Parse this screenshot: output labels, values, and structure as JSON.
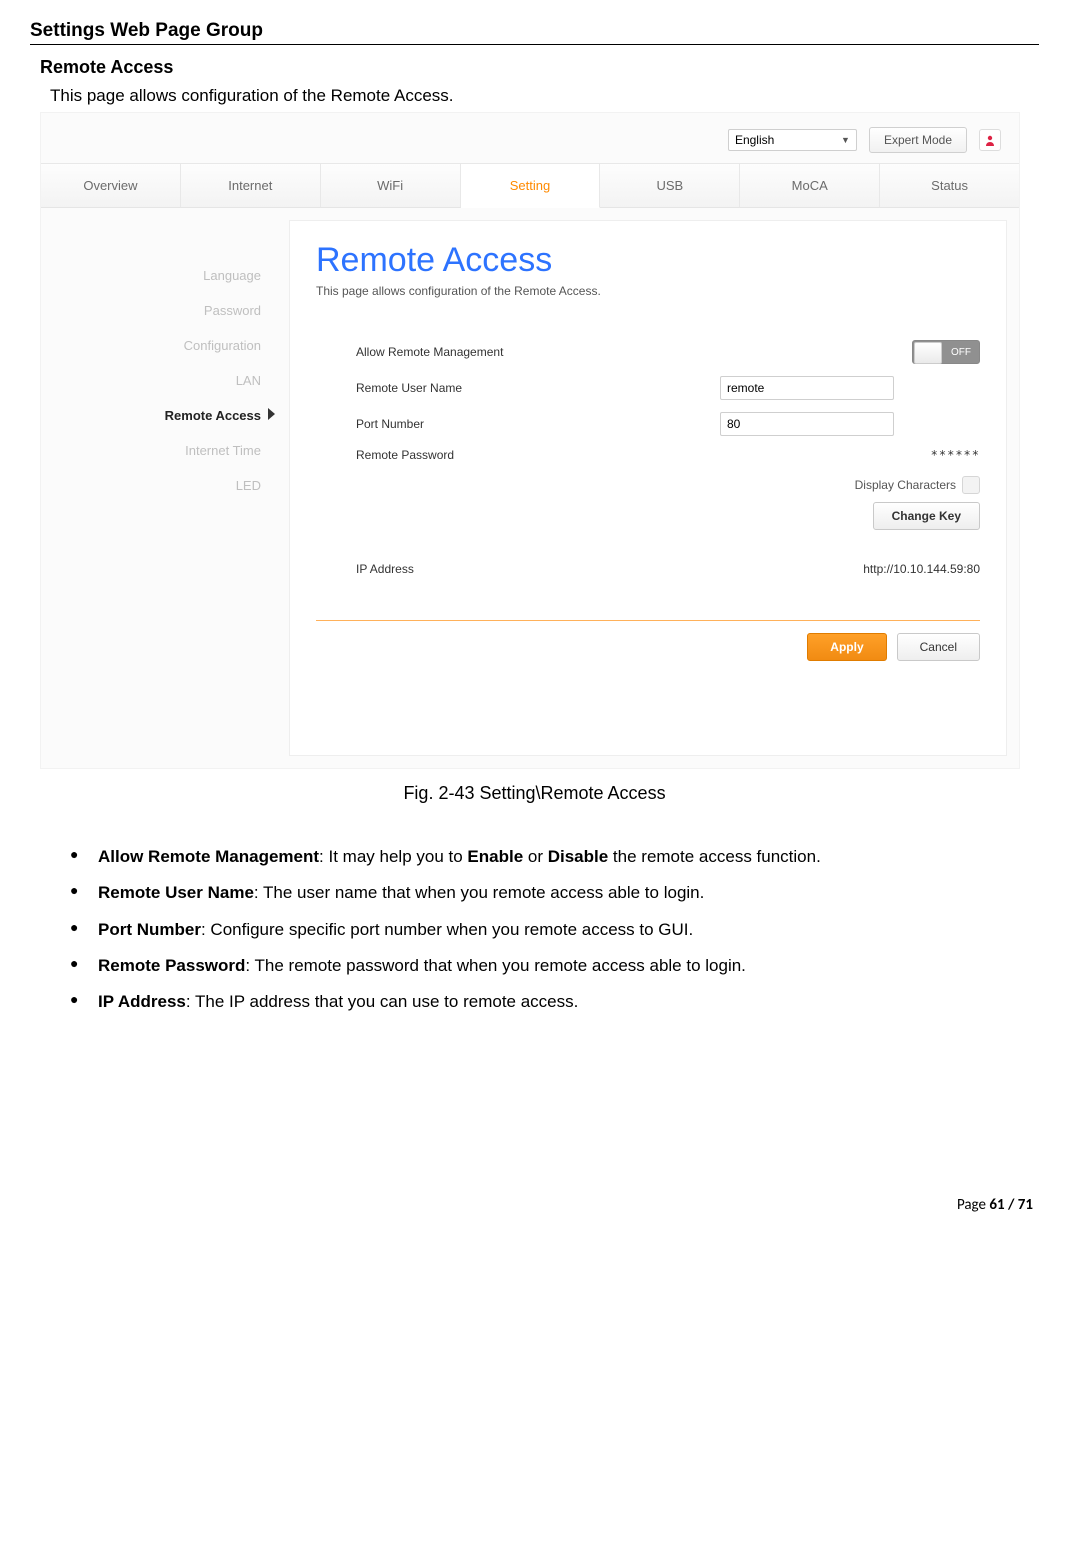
{
  "page": {
    "header": "Settings Web Page Group",
    "subsection": "Remote Access",
    "intro": "This page allows configuration of the Remote Access.",
    "caption": "Fig. 2-43 Setting\\Remote Access",
    "footer_label": "Page",
    "footer_page": "61 / 71"
  },
  "topbar": {
    "language": "English",
    "expert_button": "Expert Mode"
  },
  "tabs": [
    "Overview",
    "Internet",
    "WiFi",
    "Setting",
    "USB",
    "MoCA",
    "Status"
  ],
  "sidebar": {
    "items": [
      "Language",
      "Password",
      "Configuration",
      "LAN",
      "Remote Access",
      "Internet Time",
      "LED"
    ],
    "active_index": 4
  },
  "content": {
    "title": "Remote Access",
    "subtitle": "This page allows configuration of the Remote Access.",
    "fields": {
      "allow_label": "Allow Remote Management",
      "toggle_state": "OFF",
      "username_label": "Remote User Name",
      "username_value": "remote",
      "port_label": "Port Number",
      "port_value": "80",
      "password_label": "Remote Password",
      "password_masked": "******",
      "display_chars_label": "Display Characters",
      "change_key": "Change Key",
      "ip_label": "IP Address",
      "ip_value": "http://10.10.144.59:80",
      "apply": "Apply",
      "cancel": "Cancel"
    }
  },
  "bullets": [
    {
      "term": "Allow Remote Management",
      "sep": ": It may help you to ",
      "em1": "Enable",
      "mid": " or ",
      "em2": "Disable",
      "tail": " the remote access function."
    },
    {
      "term": "Remote User Name",
      "text": ": The user name that when you remote access able to login."
    },
    {
      "term": "Port Number",
      "text": ": Configure specific port number when you remote access to GUI."
    },
    {
      "term": "Remote Password",
      "text": ": The remote password that when you remote access able to login."
    },
    {
      "term": "IP Address",
      "text": ": The IP address that you can use to remote access."
    }
  ]
}
